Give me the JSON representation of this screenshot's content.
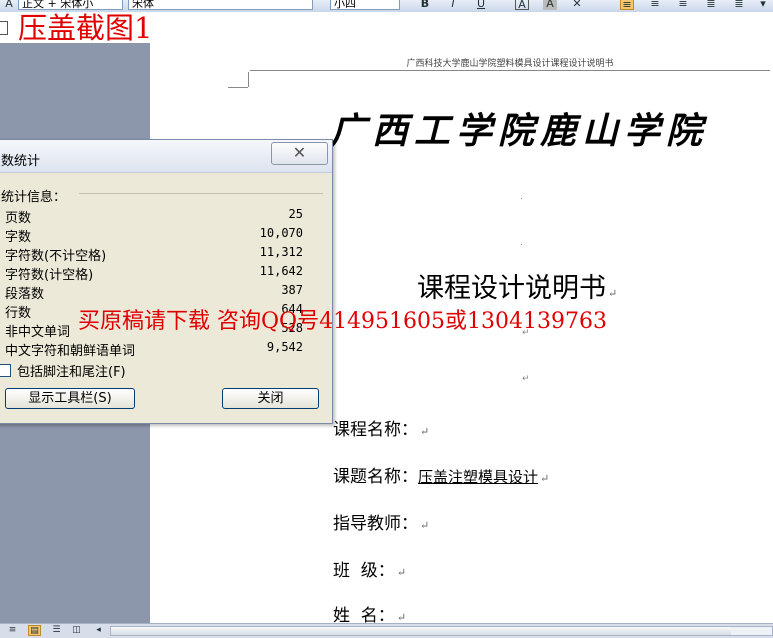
{
  "toolbar": {
    "style_value": "正文 + 宋体小",
    "font_value": "宋体",
    "size_value": "小四"
  },
  "overlay": {
    "cover_title": "压盖截图1",
    "watermark": "买原稿请下载 咨询QQ号414951605或1304139763"
  },
  "document": {
    "header_text": "广西科技大学鹿山学院塑料模具设计课程设计说明书",
    "school_name": "广西工学院鹿山学院",
    "title": "课程设计说明书",
    "fields": [
      {
        "label": "课程名称：",
        "value": ""
      },
      {
        "label": "课题名称：",
        "value": "压盖注塑模具设计"
      },
      {
        "label": "指导教师：",
        "value": ""
      },
      {
        "label": "班  级：",
        "value": ""
      },
      {
        "label": "姓  名：",
        "value": ""
      }
    ]
  },
  "dialog": {
    "title": "数统计",
    "group_label": "统计信息：",
    "stats": [
      {
        "label": "页数",
        "value": "25"
      },
      {
        "label": "字数",
        "value": "10,070"
      },
      {
        "label": "字符数(不计空格)",
        "value": "11,312"
      },
      {
        "label": "字符数(计空格)",
        "value": "11,642"
      },
      {
        "label": "段落数",
        "value": "387"
      },
      {
        "label": "行数",
        "value": "644"
      },
      {
        "label": "非中文单词",
        "value": "528"
      },
      {
        "label": "中文字符和朝鲜语单词",
        "value": "9,542"
      }
    ],
    "checkbox_label": "包括脚注和尾注(F)",
    "show_toolbar_button": "显示工具栏(S)",
    "close_button": "关闭"
  }
}
